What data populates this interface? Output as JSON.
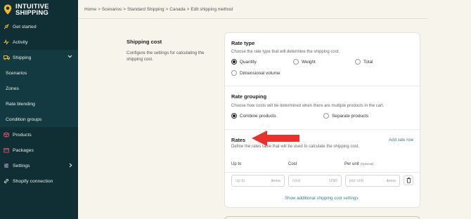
{
  "brand": {
    "line1": "INTUITIVE",
    "line2": "SHIPPING"
  },
  "sidebar": {
    "items": [
      {
        "label": "Get started",
        "icon": "rocket-icon"
      },
      {
        "label": "Activity",
        "icon": "activity-icon"
      },
      {
        "label": "Shipping",
        "icon": "truck-icon"
      },
      {
        "label": "Scenarios"
      },
      {
        "label": "Zones"
      },
      {
        "label": "Rate blending"
      },
      {
        "label": "Condition groups"
      },
      {
        "label": "Products",
        "icon": "box-icon"
      },
      {
        "label": "Packages",
        "icon": "package-icon"
      },
      {
        "label": "Settings",
        "icon": "gear-icon"
      },
      {
        "label": "Shopify connection",
        "icon": "link-icon"
      }
    ]
  },
  "breadcrumb": [
    "Home",
    "Scenarios",
    "Standard Shipping",
    "Canada",
    "Edit shipping method"
  ],
  "breadcrumb_sep": ">",
  "section": {
    "title": "Shipping cost",
    "description": "Configure the settings for calculating the shipping cost."
  },
  "rate_type": {
    "title": "Rate type",
    "description": "Choose the rate type that will determine the shipping cost.",
    "options": [
      "Quantity",
      "Weight",
      "Total",
      "Dimensional volume"
    ],
    "selected": "Quantity"
  },
  "rate_grouping": {
    "title": "Rate grouping",
    "description": "Choose how costs will be determined when there are multiple products in the cart.",
    "options": [
      "Combine products",
      "Separate products"
    ],
    "selected": "Combine products"
  },
  "rates": {
    "title": "Rates",
    "description": "Define the rates table that will be used to calculate the shipping cost.",
    "add_label": "Add rate row",
    "columns": {
      "up_to": "Up to",
      "cost": "Cost",
      "per_unit": "Per unit",
      "optional": "(Optional)"
    },
    "row": {
      "up_to_placeholder": "up to",
      "up_to_unit": "items",
      "cost_placeholder": "cost",
      "cost_unit": "USD",
      "per_unit_placeholder": "per unit",
      "per_unit_unit": "items"
    },
    "show_additional": "Show additional shipping cost settings"
  },
  "colors": {
    "sidebar": "#0f2f35",
    "accent": "#f0b92a",
    "link": "#3a7f86",
    "arrow": "#e8322b"
  }
}
